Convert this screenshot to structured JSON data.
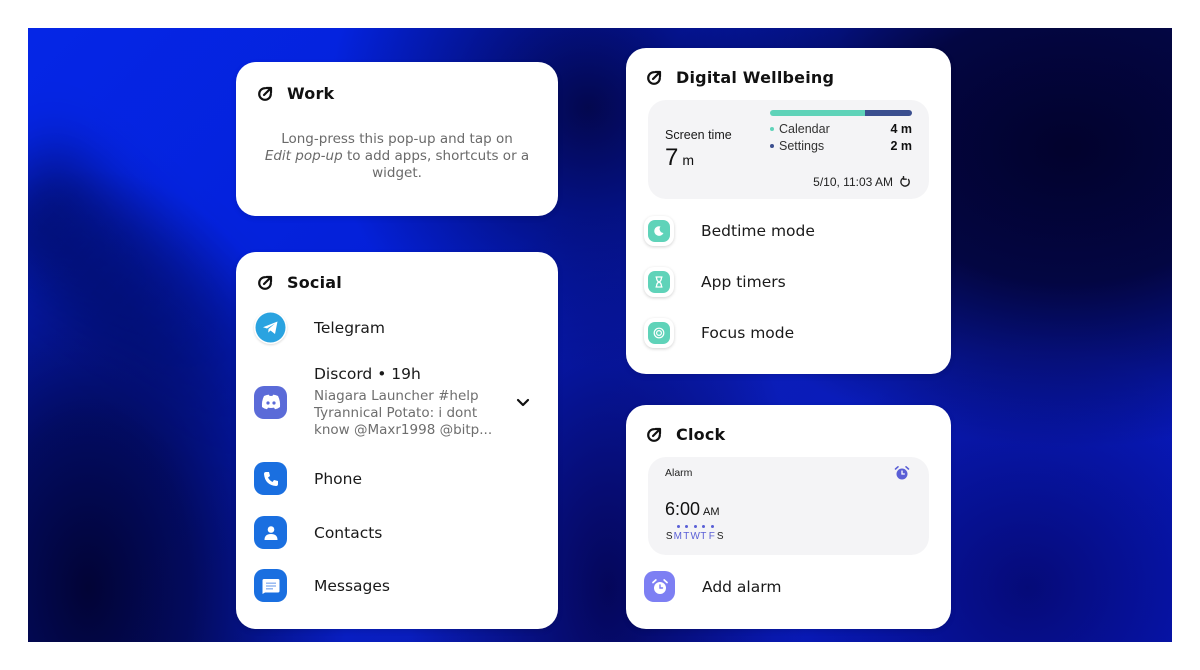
{
  "colors": {
    "wallpaper_blue": "#0526e6",
    "wallpaper_dark": "#02022d",
    "card_bg": "#ffffff",
    "panel_bg": "#f4f4f6",
    "telegram": "#2aa3e0",
    "discord": "#5b6bd8",
    "phone_blue": "#1a6fe0",
    "wellbeing_teal": "#5fd3b9",
    "settings_navy": "#3b4f8f",
    "alarm_purple": "#5a5fd6",
    "add_alarm_purple": "#7d7ff3"
  },
  "work": {
    "title": "Work",
    "hint_part1": "Long-press this pop-up and tap on",
    "hint_emphasis": "Edit pop-up",
    "hint_part2": " to add apps, shortcuts or a widget."
  },
  "social": {
    "title": "Social",
    "apps": [
      {
        "label": "Telegram",
        "icon": "telegram-icon"
      },
      {
        "label": "Discord",
        "icon": "discord-icon",
        "time": "19h",
        "notification": "Niagara Launcher #help Tyrannical Potato: i dont know @Maxr1998 @bitp..."
      },
      {
        "label": "Phone",
        "icon": "phone-icon"
      },
      {
        "label": "Contacts",
        "icon": "contacts-icon"
      },
      {
        "label": "Messages",
        "icon": "messages-icon"
      }
    ]
  },
  "wellbeing": {
    "title": "Digital Wellbeing",
    "screen_time_label": "Screen time",
    "screen_time_value": "7",
    "screen_time_unit": "m",
    "usage": [
      {
        "app": "Calendar",
        "minutes": "4 m",
        "share": 0.67,
        "color": "#5fd3b9"
      },
      {
        "app": "Settings",
        "minutes": "2 m",
        "share": 0.33,
        "color": "#3b4f8f"
      }
    ],
    "updated": "5/10, 11:03 AM",
    "actions": [
      {
        "label": "Bedtime mode",
        "icon": "moon-icon"
      },
      {
        "label": "App timers",
        "icon": "hourglass-icon"
      },
      {
        "label": "Focus mode",
        "icon": "focus-icon"
      }
    ]
  },
  "clock": {
    "title": "Clock",
    "alarm_label": "Alarm",
    "alarm_time": "6:00",
    "alarm_ampm": "AM",
    "days": [
      {
        "letter": "S",
        "active": false
      },
      {
        "letter": "M",
        "active": true
      },
      {
        "letter": "T",
        "active": true
      },
      {
        "letter": "W",
        "active": true
      },
      {
        "letter": "T",
        "active": true
      },
      {
        "letter": "F",
        "active": true
      },
      {
        "letter": "S",
        "active": false
      }
    ],
    "add_alarm_label": "Add alarm"
  }
}
